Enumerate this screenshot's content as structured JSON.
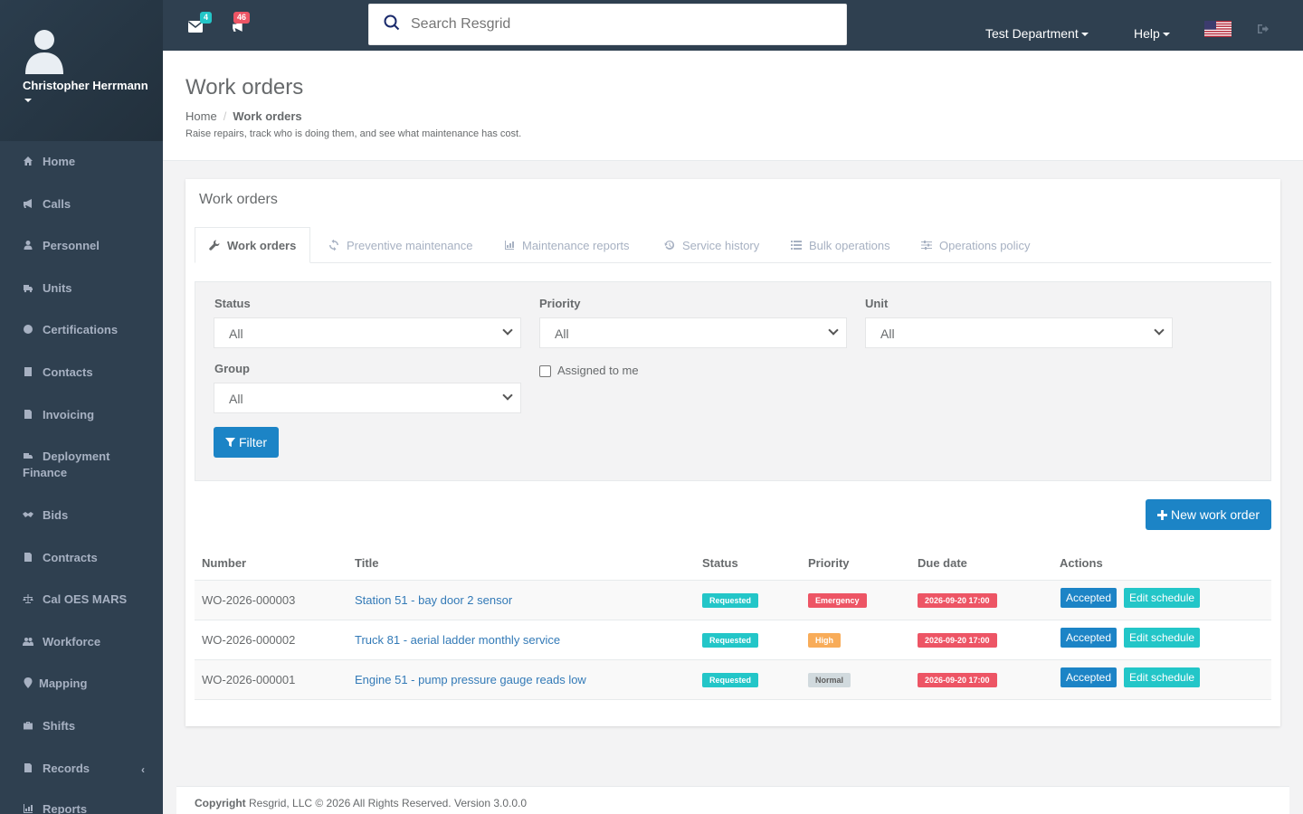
{
  "user": {
    "name": "Christopher Herrmann"
  },
  "sidebar": {
    "items": [
      {
        "label": "Home",
        "icon": "home-icon"
      },
      {
        "label": "Calls",
        "icon": "bullhorn-icon"
      },
      {
        "label": "Personnel",
        "icon": "user-icon"
      },
      {
        "label": "Units",
        "icon": "truck-icon"
      },
      {
        "label": "Certifications",
        "icon": "certificate-icon"
      },
      {
        "label": "Contacts",
        "icon": "address-book-icon"
      },
      {
        "label": "Invoicing",
        "icon": "file-icon"
      },
      {
        "label": "Deployment",
        "label2": "Finance",
        "icon": "truck-icon"
      },
      {
        "label": "Bids",
        "icon": "handshake-icon"
      },
      {
        "label": "Contracts",
        "icon": "file-icon"
      },
      {
        "label": "Cal OES MARS",
        "icon": "balance-scale-icon"
      },
      {
        "label": "Workforce",
        "icon": "users-icon"
      },
      {
        "label": "Mapping",
        "icon": "map-marker-icon"
      },
      {
        "label": "Shifts",
        "icon": "briefcase-icon"
      },
      {
        "label": "Records",
        "icon": "file-icon",
        "arrow": "‹"
      },
      {
        "label": "Reports",
        "icon": "chart-icon"
      }
    ]
  },
  "topbar": {
    "mail_count": "4",
    "calls_count": "46",
    "search_placeholder": "Search Resgrid",
    "department": "Test Department",
    "help": "Help"
  },
  "heading": {
    "title": "Work orders",
    "breadcrumb_home": "Home",
    "breadcrumb_current": "Work orders",
    "description": "Raise repairs, track who is doing them, and see what maintenance has cost."
  },
  "card": {
    "title": "Work orders",
    "tabs": [
      {
        "label": "Work orders",
        "icon": "wrench-icon"
      },
      {
        "label": "Preventive maintenance",
        "icon": "refresh-icon"
      },
      {
        "label": "Maintenance reports",
        "icon": "bar-chart-icon"
      },
      {
        "label": "Service history",
        "icon": "history-icon"
      },
      {
        "label": "Bulk operations",
        "icon": "list-icon"
      },
      {
        "label": "Operations policy",
        "icon": "sliders-icon"
      }
    ]
  },
  "filters": {
    "status_label": "Status",
    "status_value": "All",
    "priority_label": "Priority",
    "priority_value": "All",
    "unit_label": "Unit",
    "unit_value": "All",
    "group_label": "Group",
    "group_value": "All",
    "assigned_label": "Assigned to me",
    "filter_button": "Filter"
  },
  "new_button": "New work order",
  "table": {
    "headers": [
      "Number",
      "Title",
      "Status",
      "Priority",
      "Due date",
      "Actions"
    ],
    "rows": [
      {
        "number": "WO-2026-000003",
        "title": "Station 51 - bay door 2 sensor",
        "status": "Requested",
        "priority": "Emergency",
        "priority_color": "#ed5565",
        "due": "2026-09-20 17:00",
        "action1": "Accepted",
        "action2": "Edit schedule"
      },
      {
        "number": "WO-2026-000002",
        "title": "Truck 81 - aerial ladder monthly service",
        "status": "Requested",
        "priority": "High",
        "priority_color": "#f8ac59",
        "due": "2026-09-20 17:00",
        "action1": "Accepted",
        "action2": "Edit schedule"
      },
      {
        "number": "WO-2026-000001",
        "title": "Engine 51 - pump pressure gauge reads low",
        "status": "Requested",
        "priority": "Normal",
        "priority_color": "#d1dade",
        "due": "2026-09-20 17:00",
        "action1": "Accepted",
        "action2": "Edit schedule"
      }
    ]
  },
  "footer": {
    "copyright_bold": "Copyright",
    "copyright_text": "Resgrid, LLC © 2026 All Rights Reserved.",
    "version": "Version 3.0.0.0"
  },
  "colors": {
    "sidebar": "#2f4050",
    "primary": "#1c84c6",
    "info": "#23c6c8",
    "danger": "#ed5565",
    "warning": "#f8ac59"
  }
}
